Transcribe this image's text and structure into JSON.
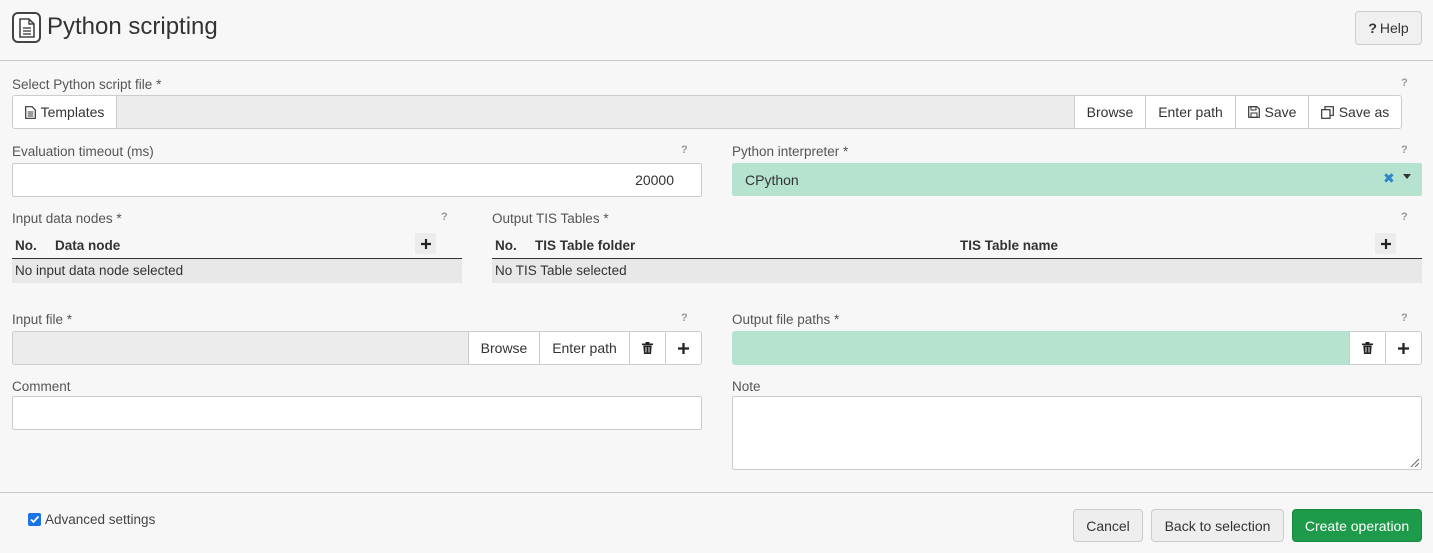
{
  "header": {
    "title": "Python scripting",
    "help_label": "Help",
    "help_mark": "?"
  },
  "script_file": {
    "label": "Select Python script file *",
    "help": "?",
    "templates_label": "Templates",
    "browse_label": "Browse",
    "enter_path_label": "Enter path",
    "save_label": "Save",
    "save_as_label": "Save as"
  },
  "timeout": {
    "label": "Evaluation timeout (ms)",
    "help": "?",
    "value": "20000"
  },
  "interpreter": {
    "label": "Python interpreter *",
    "help": "?",
    "value": "CPython"
  },
  "input_nodes": {
    "label": "Input data nodes *",
    "help": "?",
    "columns": [
      "No.",
      "Data node"
    ],
    "empty_text": "No input data node selected"
  },
  "output_tables": {
    "label": "Output TIS Tables *",
    "help": "?",
    "columns": [
      "No.",
      "TIS Table folder",
      "TIS Table name"
    ],
    "empty_text": "No TIS Table selected"
  },
  "input_file": {
    "label": "Input file *",
    "help": "?",
    "browse_label": "Browse",
    "enter_path_label": "Enter path"
  },
  "output_paths": {
    "label": "Output file paths *",
    "help": "?"
  },
  "comment": {
    "label": "Comment"
  },
  "note": {
    "label": "Note"
  },
  "footer": {
    "advanced_label": "Advanced settings",
    "advanced_checked": true,
    "cancel_label": "Cancel",
    "back_label": "Back to selection",
    "create_label": "Create operation"
  },
  "colors": {
    "accent_green": "#b5e3d0",
    "primary": "#1e9a4b",
    "clear_icon": "#2f86c8"
  }
}
